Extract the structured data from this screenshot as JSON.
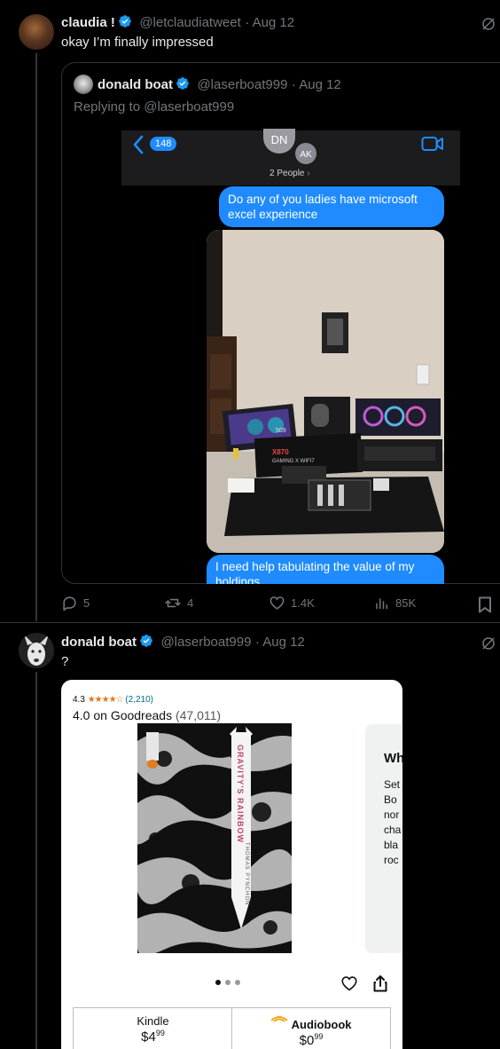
{
  "tweet1": {
    "display_name": "claudia !",
    "handle": "@letclaudiatweet",
    "date": "Aug 12",
    "text": "okay I’m finally impressed",
    "quote": {
      "display_name": "donald boat",
      "handle": "@laserboat999",
      "date": "Aug 12",
      "replying_to": "Replying to @laserboat999",
      "imessage": {
        "back_count": "148",
        "avatar_1": "DN",
        "avatar_2": "AK",
        "people": "2 People",
        "bubble_1": "Do any of you ladies have microsoft excel experience",
        "bubble_2": "I need help tabulating the value of my holdings",
        "photo_text": {
          "gpu_series": "X870",
          "gpu_brand": "GAMING X WIFI7",
          "small_label": "509"
        }
      }
    },
    "actions": {
      "replies": "5",
      "reposts": "4",
      "likes": "1.4K",
      "views": "85K"
    }
  },
  "tweet2": {
    "display_name": "donald boat",
    "handle": "@laserboat999",
    "date": "Aug 12",
    "text": "?",
    "amazon": {
      "rating": "4.3",
      "rating_count": "(2,210)",
      "goodreads": "4.0 on Goodreads",
      "goodreads_count": "(47,011)",
      "book_title": "GRAVITY'S RAINBOW",
      "book_author": "THOMAS PYNCHON",
      "side_heading": "Wh",
      "side_lines": [
        "Set",
        "Bo",
        "nor",
        "cha",
        "bla",
        "roc"
      ],
      "kindle_label": "Kindle",
      "kindle_price_main": "$4",
      "kindle_price_cents": "99",
      "audiobook_label": "Audiobook",
      "audiobook_price_main": "$0",
      "audiobook_price_cents": "99"
    }
  },
  "colors": {
    "background": "#000000",
    "text": "#e7e9ea",
    "muted": "#71767b",
    "verified": "#1d9bf0",
    "imessage_blue": "#1f8bff",
    "amazon_star": "#de7921"
  }
}
